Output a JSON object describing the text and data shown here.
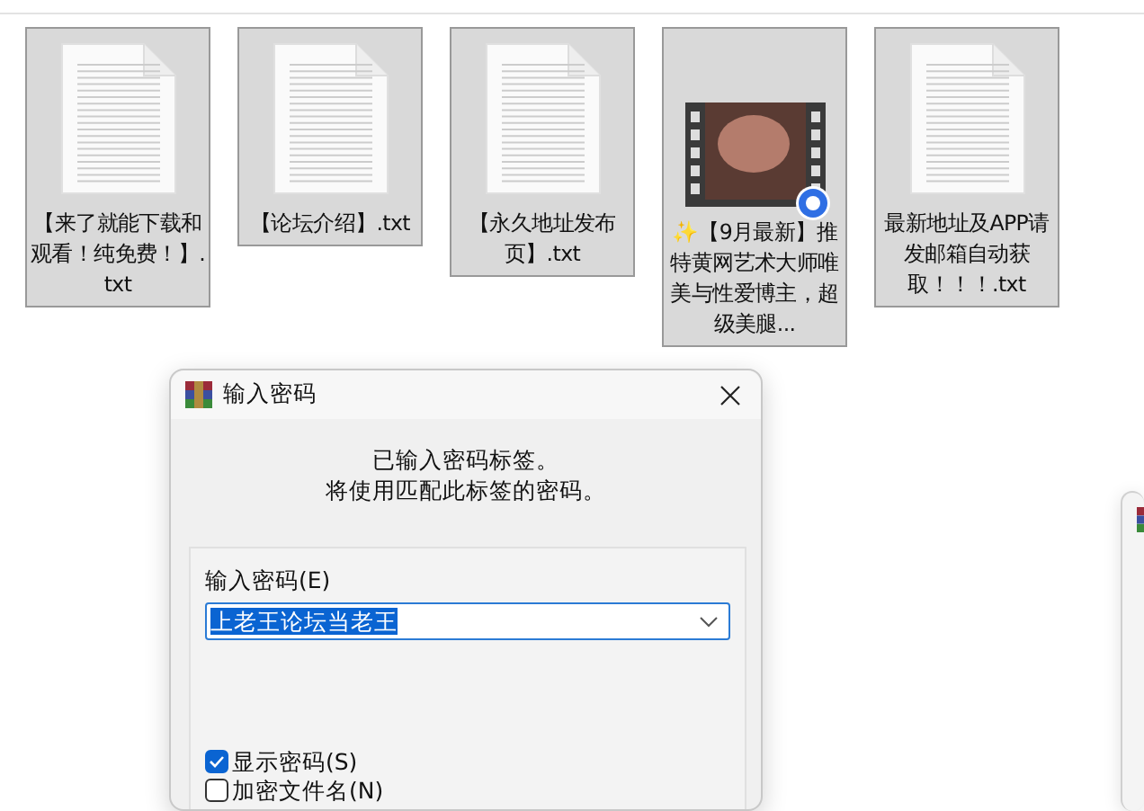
{
  "files": [
    {
      "name": "【来了就能下载和观看！纯免费！】.txt",
      "kind": "text"
    },
    {
      "name": "【论坛介绍】.txt",
      "kind": "text"
    },
    {
      "name": "【永久地址发布页】.txt",
      "kind": "text"
    },
    {
      "name": "✨【9月最新】推特黄网艺术大师唯美与性爱博主，超级美腿...",
      "kind": "video"
    },
    {
      "name": "最新地址及APP请发邮箱自动获取！！！.txt",
      "kind": "text"
    }
  ],
  "dialog": {
    "title": "输入密码",
    "message": [
      "已输入密码标签。",
      "将使用匹配此标签的密码。"
    ],
    "password_label": "输入密码(E)",
    "password_value": "上老王论坛当老王",
    "options": [
      {
        "label": "显示密码(S)",
        "checked": true
      },
      {
        "label": "加密文件名(N)",
        "checked": false
      }
    ]
  }
}
